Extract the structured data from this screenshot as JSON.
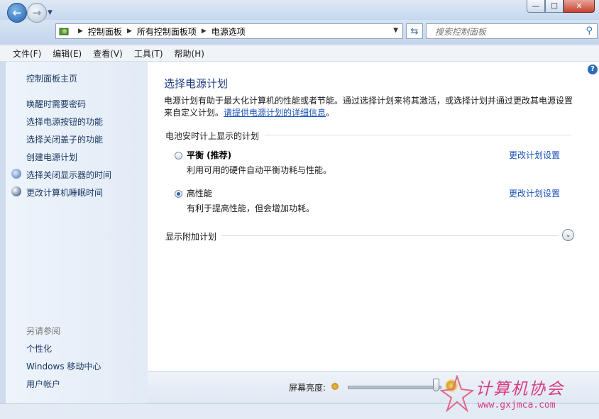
{
  "window": {
    "minimize_glyph": "—",
    "maximize_glyph": "☐",
    "close_glyph": "✕"
  },
  "nav": {
    "breadcrumbs": [
      "控制面板",
      "所有控制面板项",
      "电源选项"
    ],
    "search_placeholder": "搜索控制面板"
  },
  "menu": {
    "items": [
      "文件(F)",
      "编辑(E)",
      "查看(V)",
      "工具(T)",
      "帮助(H)"
    ]
  },
  "sidebar": {
    "home": "控制面板主页",
    "items": [
      "唤醒时需要密码",
      "选择电源按钮的功能",
      "选择关闭盖子的功能",
      "创建电源计划",
      "选择关闭显示器的时间",
      "更改计算机睡眠时间"
    ],
    "see_also_title": "另请参阅",
    "see_also": [
      "个性化",
      "Windows 移动中心",
      "用户帐户"
    ]
  },
  "main": {
    "title": "选择电源计划",
    "description": "电源计划有助于最大化计算机的性能或者节能。通过选择计划来将其激活，或选择计划并通过更改其电源设置来自定义计划。",
    "description_link": "请提供电源计划的详细信息",
    "description_end": "。",
    "group_title": "电池安时计上显示的计划",
    "plans": [
      {
        "name": "平衡 (推荐)",
        "desc": "利用可用的硬件自动平衡功耗与性能。",
        "link": "更改计划设置",
        "selected": false
      },
      {
        "name": "高性能",
        "desc": "有利于提高性能，但会增加功耗。",
        "link": "更改计划设置",
        "selected": true
      }
    ],
    "additional": "显示附加计划",
    "help": "?"
  },
  "bottom": {
    "brightness_label": "屏幕亮度:",
    "brightness_level": 0.95
  },
  "watermark": {
    "title": "计算机协会",
    "url": "www.gxjmca.com"
  },
  "colors": {
    "link": "#1a52b8",
    "title": "#1e3d82",
    "sidebar_bg": "#e9f0f9",
    "watermark": "#d63a82"
  }
}
